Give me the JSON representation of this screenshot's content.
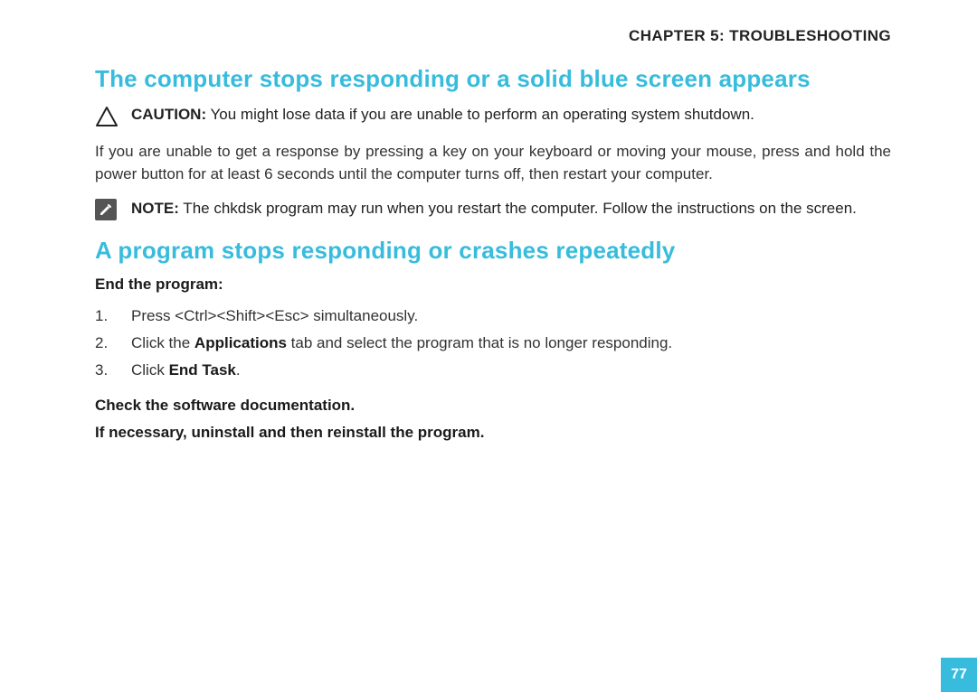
{
  "header": {
    "chapter": "CHAPTER 5: TROUBLESHOOTING"
  },
  "section1": {
    "heading": "The computer stops responding or a solid blue screen appears",
    "caution": {
      "lead": "CAUTION:",
      "text": " You might lose data if you are unable to perform an operating system shutdown."
    },
    "para": "If you are unable to get a response by pressing a key on your keyboard or moving your mouse, press and hold the power button for at least 6 seconds until the computer turns off, then restart your computer.",
    "note": {
      "lead": "NOTE:",
      "text": " The chkdsk program may run when you restart the computer. Follow the instructions on the screen."
    }
  },
  "section2": {
    "heading": "A program stops responding or crashes repeatedly",
    "endProgramLabel": "End the program:",
    "steps": [
      {
        "n": "1.",
        "pre": "Press <Ctrl><Shift><Esc> simultaneously.",
        "strong": "",
        "post": ""
      },
      {
        "n": "2.",
        "pre": "Click the ",
        "strong": "Applications",
        "post": " tab and select the program that is no longer responding."
      },
      {
        "n": "3.",
        "pre": "Click ",
        "strong": "End Task",
        "post": "."
      }
    ],
    "checkDocs": "Check the software documentation.",
    "reinstall": "If necessary, uninstall and then reinstall the program."
  },
  "pageNumber": "77"
}
